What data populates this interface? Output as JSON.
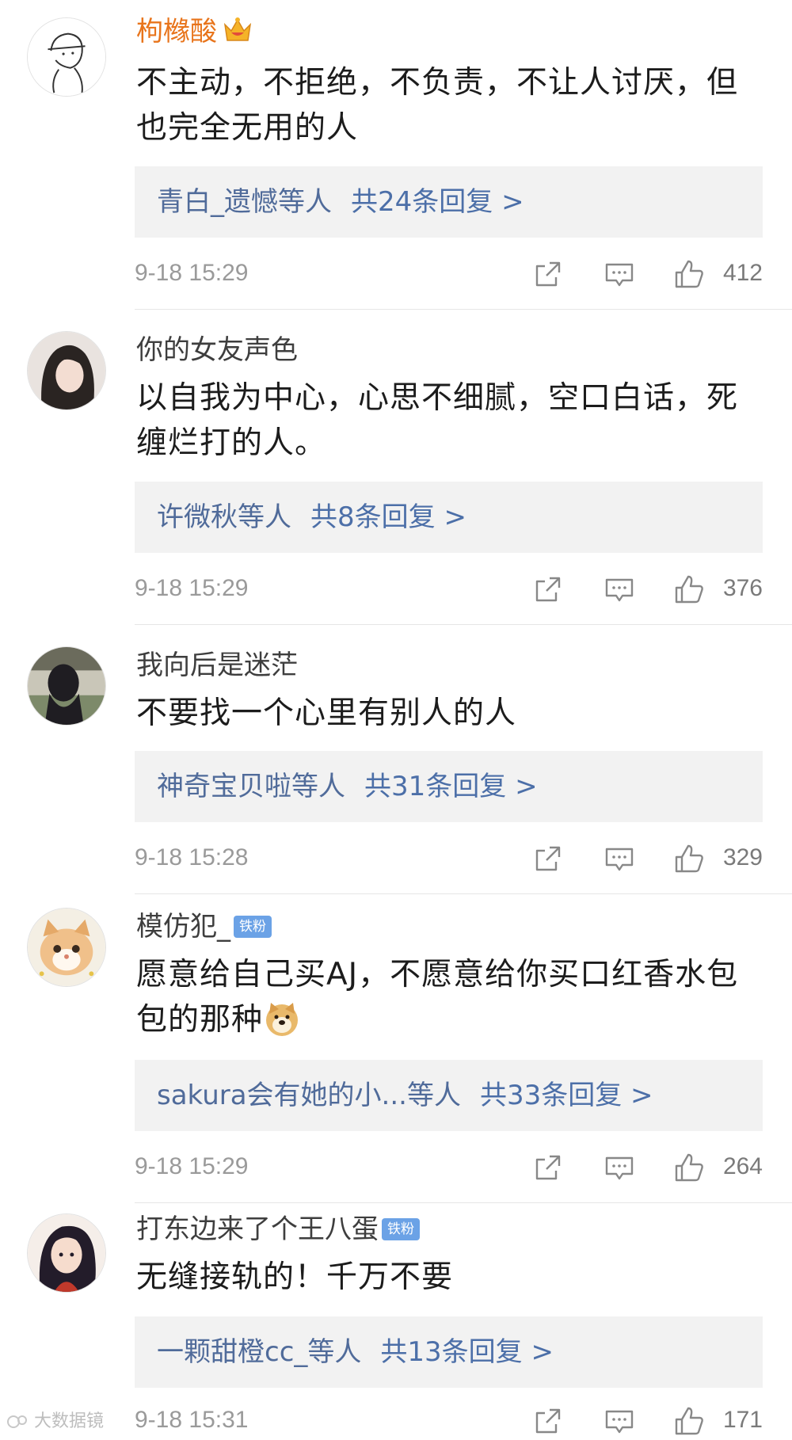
{
  "comments": [
    {
      "username": "枸橼酸",
      "text": "不主动，不拒绝，不负责，不让人讨厌，但也完全无用的人",
      "reply_names": "青白_遗憾",
      "reply_suffix": "等人",
      "reply_count": "共24条回复 >",
      "time": "9-18 15:29",
      "likes": "412"
    },
    {
      "username": "你的女友声色",
      "text": "以自我为中心，心思不细腻，空口白话，死缠烂打的人。",
      "reply_names": "许微秋",
      "reply_suffix": "等人",
      "reply_count": "共8条回复 >",
      "time": "9-18 15:29",
      "likes": "376"
    },
    {
      "username": "我向后是迷茫",
      "text": "不要找一个心里有别人的人",
      "reply_names": "神奇宝贝啦",
      "reply_suffix": "等人",
      "reply_count": "共31条回复 >",
      "time": "9-18 15:28",
      "likes": "329"
    },
    {
      "username": "模仿犯_",
      "badge": "铁粉",
      "text": "愿意给自己买AJ，不愿意给你买口红香水包包的那种",
      "reply_names": "sakura会有她的小...",
      "reply_suffix": "等人",
      "reply_count": "共33条回复 >",
      "time": "9-18 15:29",
      "likes": "264"
    },
    {
      "username": "打东边来了个王八蛋",
      "badge": "铁粉",
      "text": "无缝接轨的！千万不要",
      "reply_names": "一颗甜橙cc_",
      "reply_suffix": "等人",
      "reply_count": "共13条回复 >",
      "time": "9-18 15:31",
      "likes": "171"
    }
  ],
  "watermark": "大数据镜",
  "icons": {
    "crown": "crown-icon",
    "share": "share-icon",
    "comment": "comment-icon",
    "like": "thumbs-up-icon",
    "doge": "doge-emoji-icon"
  },
  "colors": {
    "vip_name": "#e8741b",
    "reply_link": "#506b9a",
    "badge": "#6ba2e6",
    "reply_bg": "#f2f2f2"
  }
}
